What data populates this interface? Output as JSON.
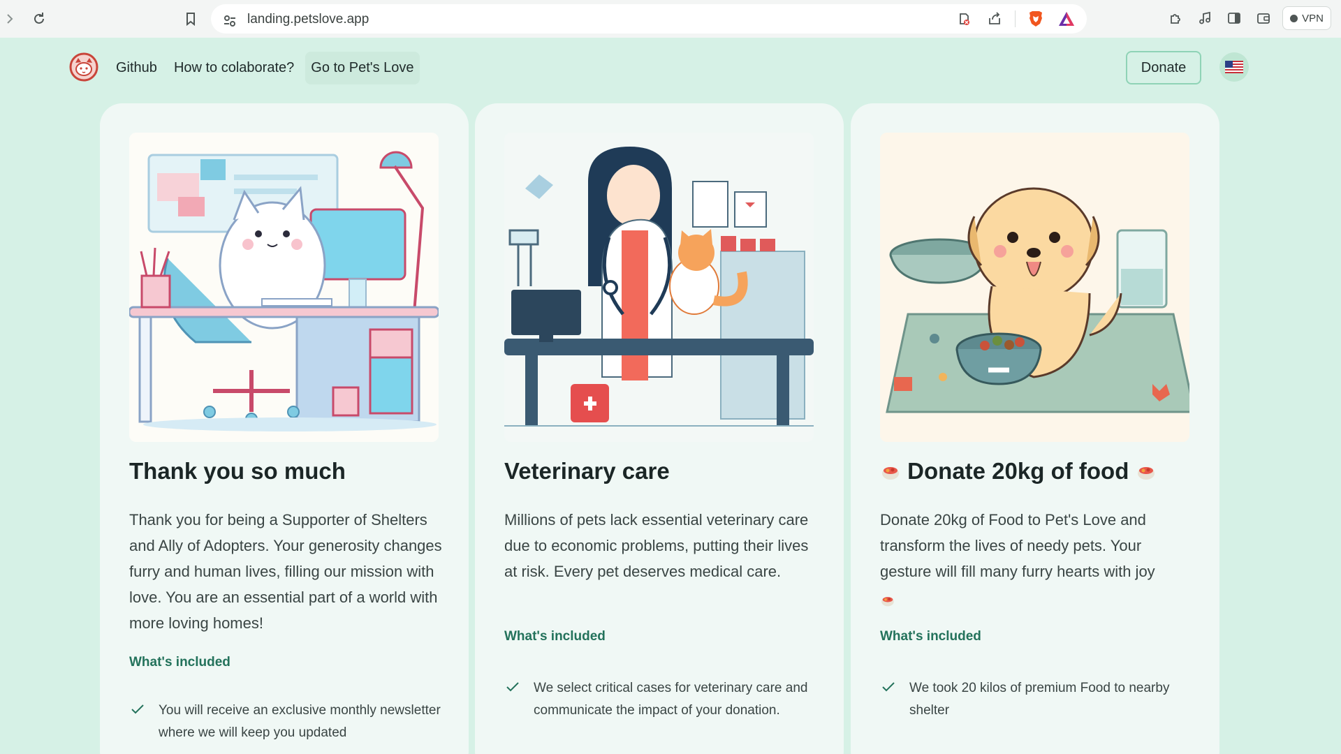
{
  "browser": {
    "url": "landing.petslove.app",
    "vpn_label": "VPN"
  },
  "header": {
    "nav": [
      {
        "label": "Github"
      },
      {
        "label": "How to colaborate?"
      },
      {
        "label": "Go to Pet's Love"
      }
    ],
    "donate_label": "Donate",
    "language_icon": "us-flag-icon"
  },
  "cards": [
    {
      "title": "Thank you so much",
      "description": "Thank you for being a Supporter of Shelters and Ally of Adopters. Your generosity changes furry and human lives, filling our mission with love. You are an essential part of a world with more loving homes!",
      "included_label": "What's included",
      "features": [
        "You will receive an exclusive monthly newsletter where we will keep you updated"
      ]
    },
    {
      "title": "Veterinary care",
      "description": "Millions of pets lack essential veterinary care due to economic problems, putting their lives at risk. Every pet deserves medical care.",
      "included_label": "What's included",
      "features": [
        "We select critical cases for veterinary care and communicate the impact of your donation."
      ]
    },
    {
      "title": "Donate 20kg of food",
      "description": "Donate 20kg of Food to Pet's Love and transform the lives of needy pets. Your gesture will fill many furry hearts with joy",
      "included_label": "What's included",
      "features": [
        "We took 20 kilos of premium Food to nearby shelter"
      ]
    }
  ],
  "colors": {
    "page_bg": "#d6f1e6",
    "card_bg": "#f0f8f5",
    "accent_green": "#23725b"
  }
}
